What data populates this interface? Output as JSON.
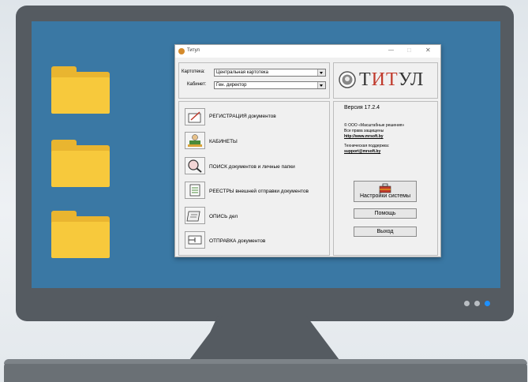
{
  "window": {
    "title": "Титул"
  },
  "left": {
    "kartoteka_label": "Картотека:",
    "kartoteka_value": "Центральная картотека",
    "kabinet_label": "Кабинет:",
    "kabinet_value": "Ген. директор",
    "nav": [
      {
        "label": "РЕГИСТРАЦИЯ  документов",
        "icon": "registration-icon"
      },
      {
        "label": "КАБИНЕТЫ",
        "icon": "cabinet-person-icon"
      },
      {
        "label": "ПОИСК  документов и личные папки",
        "icon": "magnifier-icon"
      },
      {
        "label": "РЕЕСТРЫ  внешней отправки документов",
        "icon": "registry-icon"
      },
      {
        "label": "ОПИСЬ дел",
        "icon": "inventory-icon"
      },
      {
        "label": "ОТПРАВКА документов",
        "icon": "send-icon"
      }
    ]
  },
  "right": {
    "logo_text": "ТИТУЛ",
    "version": "Версия 17.2.4",
    "copyright": "© ООО «Масштабные решения»",
    "rights": "Все права защищены",
    "site": "http://www.mrsoft.by",
    "support_label": "Техническая поддержка:",
    "support_email": "support@mrsoft.by",
    "settings_label": "Настройки системы",
    "help_label": "Помощь",
    "exit_label": "Выход"
  },
  "colors": {
    "screen": "#3a78a4",
    "bezel": "#555b61",
    "folder": "#f7c93c",
    "accent_dot": "#1e90ff",
    "logo_red": "#c0392b"
  }
}
